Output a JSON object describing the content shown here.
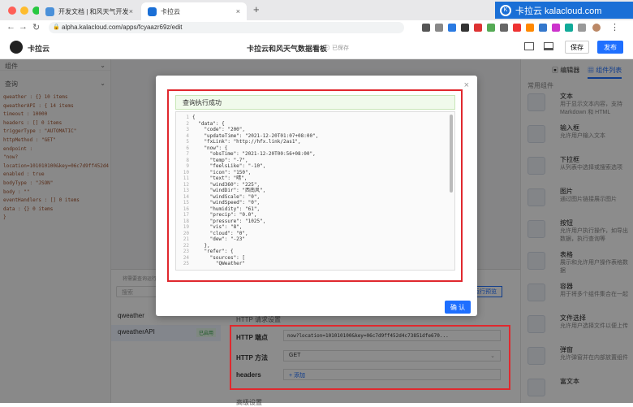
{
  "browser": {
    "tabs": [
      {
        "label": "开发文档 | 和风天气开发平台",
        "active": false
      },
      {
        "label": "卡拉云",
        "active": true
      }
    ],
    "new_tab": "+",
    "url": "alpha.kalacloud.com/apps/fcyaazr69z/edit",
    "brand": "卡拉云 kalacloud.com"
  },
  "app": {
    "logo_text": "卡拉云",
    "title": "卡拉云和风天气数据看板",
    "saved_status": "已保存",
    "save_button": "保存",
    "publish_button": "发布"
  },
  "left_panel": {
    "section_components": "组件",
    "section_queries": "查询",
    "tree": [
      {
        "text": "qweather : {} 10 items"
      },
      {
        "text": "qweatherAPI : { 14 items"
      },
      {
        "text": "  timeout : 10000"
      },
      {
        "text": "  headers : [] 0 items"
      },
      {
        "text": "  triggerType : \"AUTOMATIC\""
      },
      {
        "text": "  httpMethod : \"GET\""
      },
      {
        "text": "  endpoint :"
      },
      {
        "text": "  \"now?"
      },
      {
        "text": "  location=101010100&key=06c7d9ff452d4c73851dfe670..."
      },
      {
        "text": "  enabled : true"
      },
      {
        "text": "  bodyType : \"JSON\""
      },
      {
        "text": "  body : \"\""
      },
      {
        "text": "  eventHandlers : [] 0 items"
      },
      {
        "text": "  data : {} 0 items"
      },
      {
        "text": "}"
      }
    ]
  },
  "center": {
    "search_placeholder": "搜索",
    "hint": "将需要查询运行并...",
    "queries": [
      {
        "name": "qweather"
      },
      {
        "name": "qweatherAPI",
        "badge": "已启用"
      }
    ],
    "btn_preview": "运行预览",
    "http_section": "HTTP 请求设置",
    "fields": {
      "endpoint_label": "HTTP 端点",
      "endpoint_value": "now?location=101010100&key=06c7d9ff452d4c73851dfe670...",
      "method_label": "HTTP 方法",
      "method_value": "GET",
      "headers_label": "headers",
      "headers_add": "+ 添加"
    },
    "advanced": "高级设置"
  },
  "modal": {
    "close": "×",
    "success_text": "查询执行成功",
    "ok_button": "确 认",
    "code": [
      "{",
      "  \"data\": {",
      "    \"code\": \"200\",",
      "    \"updateTime\": \"2021-12-20T01:07+08:00\",",
      "    \"fxLink\": \"http://hfx.link/2as1\",",
      "    \"now\": {",
      "      \"obsTime\": \"2021-12-20T00:56+08:00\",",
      "      \"temp\": \"-7\",",
      "      \"feelsLike\": \"-10\",",
      "      \"icon\": \"150\",",
      "      \"text\": \"晴\",",
      "      \"wind360\": \"225\",",
      "      \"windDir\": \"西南风\",",
      "      \"windScale\": \"0\",",
      "      \"windSpeed\": \"0\",",
      "      \"humidity\": \"61\",",
      "      \"precip\": \"0.0\",",
      "      \"pressure\": \"1025\",",
      "      \"vis\": \"8\",",
      "      \"cloud\": \"0\",",
      "      \"dew\": \"-23\"",
      "    },",
      "    \"refer\": {",
      "      \"sources\": [",
      "        \"QWeather\""
    ]
  },
  "right_panel": {
    "tab_editor": "编辑器",
    "tab_components": "组件列表",
    "section": "常用组件",
    "components": [
      {
        "title": "文本",
        "desc": "用于显示文本内容，支持 Markdown 和 HTML"
      },
      {
        "title": "输入框",
        "desc": "允许用户输入文本"
      },
      {
        "title": "下拉框",
        "desc": "从列表中选择或搜索选项"
      },
      {
        "title": "图片",
        "desc": "通过图片链接展示图片"
      },
      {
        "title": "按钮",
        "desc": "允许用户执行操作，如导出数据，执行查询等"
      },
      {
        "title": "表格",
        "desc": "展示和允许用户操作表格数据"
      },
      {
        "title": "容器",
        "desc": "用于将多个组件集合在一起"
      },
      {
        "title": "文件选择",
        "desc": "允许用户选择文件以便上传"
      },
      {
        "title": "弹窗",
        "desc": "允许弹窗并在内部放置组件"
      },
      {
        "title": "富文本",
        "desc": ""
      }
    ]
  },
  "colors": {
    "accent": "#1e6fff",
    "red_highlight": "#e0282e",
    "success_bg": "#f0faeb"
  }
}
